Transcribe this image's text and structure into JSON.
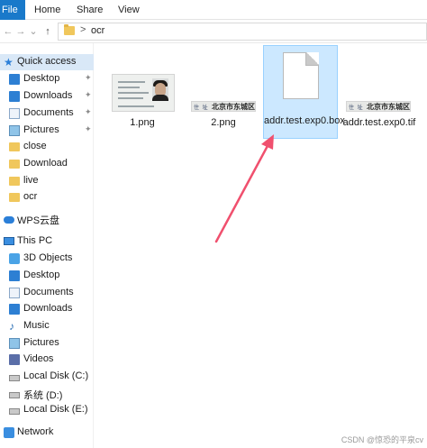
{
  "ribbon": {
    "tabs": [
      "File",
      "Home",
      "Share",
      "View"
    ]
  },
  "address": {
    "path": "ocr",
    "separator": ">"
  },
  "nav": {
    "back": "←",
    "forward": "→",
    "recent": "⌄",
    "up": "↑"
  },
  "sidebar": {
    "quick_access": "Quick access",
    "quick_items": [
      {
        "label": "Desktop",
        "icon": "desktop-icon"
      },
      {
        "label": "Downloads",
        "icon": "downloads-icon"
      },
      {
        "label": "Documents",
        "icon": "documents-icon"
      },
      {
        "label": "Pictures",
        "icon": "pictures-icon"
      },
      {
        "label": "close",
        "icon": "folder-icon"
      },
      {
        "label": "Download",
        "icon": "folder-icon"
      },
      {
        "label": "live",
        "icon": "folder-icon"
      },
      {
        "label": "ocr",
        "icon": "folder-icon"
      }
    ],
    "wps": "WPS云盘",
    "this_pc": "This PC",
    "pc_items": [
      {
        "label": "3D Objects",
        "icon": "3d-objects-icon"
      },
      {
        "label": "Desktop",
        "icon": "desktop-icon"
      },
      {
        "label": "Documents",
        "icon": "documents-icon"
      },
      {
        "label": "Downloads",
        "icon": "downloads-icon"
      },
      {
        "label": "Music",
        "icon": "music-icon"
      },
      {
        "label": "Pictures",
        "icon": "pictures-icon"
      },
      {
        "label": "Videos",
        "icon": "videos-icon"
      },
      {
        "label": "Local Disk (C:)",
        "icon": "drive-icon"
      },
      {
        "label": "系统 (D:)",
        "icon": "drive-icon"
      },
      {
        "label": "Local Disk (E:)",
        "icon": "drive-icon"
      }
    ],
    "network": "Network"
  },
  "files": [
    {
      "name": "1.png",
      "type": "id-card-image"
    },
    {
      "name": "2.png",
      "type": "address-strip-image",
      "strip_label": "住 址",
      "strip_text": "北京市东城区"
    },
    {
      "name": "addr.test.exp0.box",
      "type": "document"
    },
    {
      "name": "addr.test.exp0.tif",
      "type": "address-strip-image",
      "strip_label": "住 址",
      "strip_text": "北京市东城区"
    }
  ],
  "watermark": "CSDN @惊恐的平泉cv",
  "colors": {
    "accent": "#1979ca",
    "selection": "#cce8ff",
    "arrow": "#f0506e"
  }
}
